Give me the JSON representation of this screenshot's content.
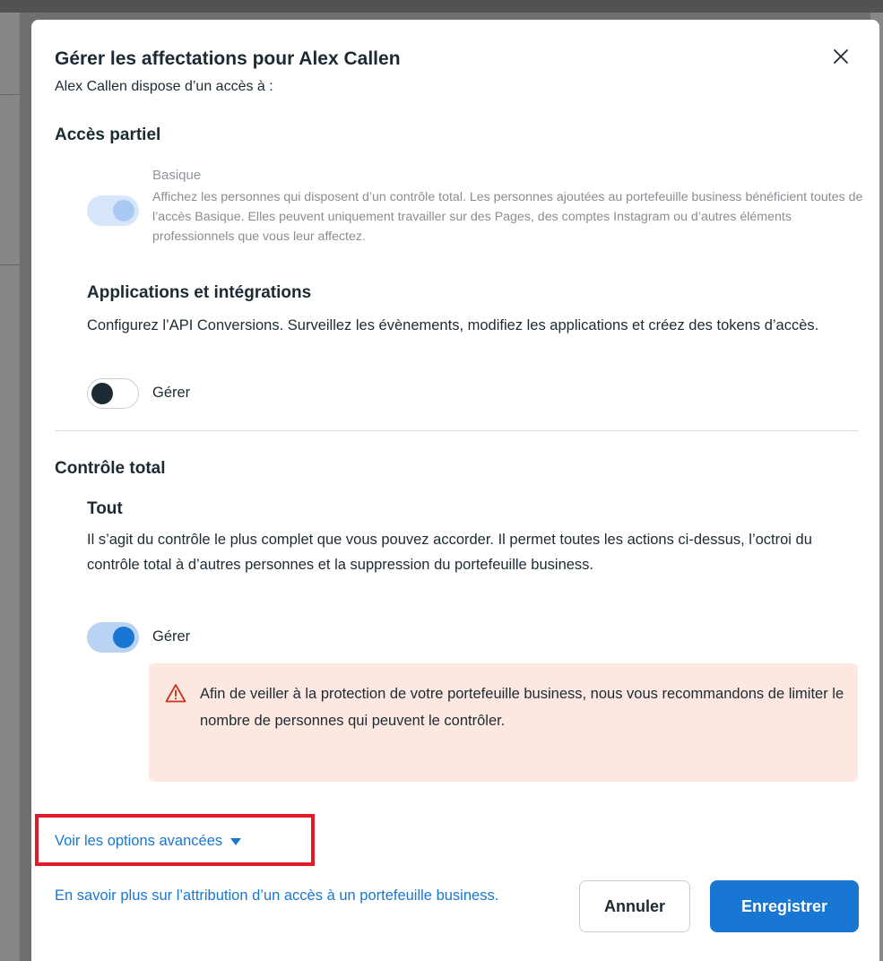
{
  "dialog": {
    "title": "Gérer les affectations pour Alex Callen",
    "subtitle": "Alex Callen dispose d’un accès à :",
    "close_icon": "close-icon"
  },
  "partial_access": {
    "heading": "Accès partiel",
    "basic": {
      "label": "Basique",
      "description": "Affichez les personnes qui disposent d’un contrôle total. Les personnes ajoutées au portefeuille business bénéficient toutes de l’accès Basique. Elles peuvent uniquement travailler sur des Pages, des comptes Instagram ou d’autres éléments professionnels que vous leur affectez.",
      "toggle_state": "on-disabled"
    },
    "apps": {
      "heading": "Applications et intégrations",
      "description": "Configurez l’API Conversions. Surveillez les évènements, modifiez les applications et créez des tokens d’accès.",
      "toggle_label": "Gérer",
      "toggle_state": "off"
    }
  },
  "full_control": {
    "heading": "Contrôle total",
    "all": {
      "heading": "Tout",
      "description": "Il s’agit du contrôle le plus complet que vous pouvez accorder. Il permet toutes les actions ci-dessus, l’octroi du contrôle total à d’autres personnes et la suppression du portefeuille business.",
      "toggle_label": "Gérer",
      "toggle_state": "on"
    },
    "warning": {
      "icon": "warning-triangle-icon",
      "text": "Afin de veiller à la protection de votre portefeuille business, nous vous recommandons de limiter le nombre de personnes qui peuvent le contrôler."
    }
  },
  "footer": {
    "advanced_link": "Voir les options avancées",
    "advanced_icon": "caret-down-icon",
    "learn_more_link": "En savoir plus sur l’attribution d’un accès à un portefeuille business.",
    "cancel_label": "Annuler",
    "save_label": "Enregistrer"
  },
  "colors": {
    "accent": "#1877d2",
    "highlight_outline": "#e21b2b",
    "warning_bg": "#fde8e1",
    "warning_icon": "#c8351b"
  }
}
